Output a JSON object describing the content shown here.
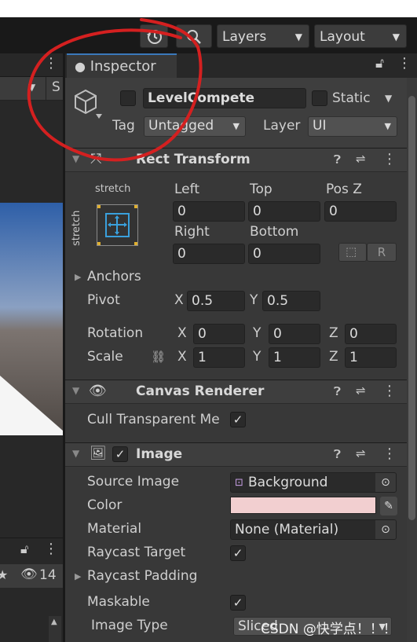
{
  "toolbar": {
    "history_icon": "history-icon",
    "search_icon": "search-icon",
    "layers_label": "Layers",
    "layout_label": "Layout"
  },
  "left_panel": {
    "tool_fragment": "S",
    "lock_icon": "lock-icon",
    "bottom_count": "14"
  },
  "inspector": {
    "tab_label": "Inspector",
    "object": {
      "name": "LevelCompete",
      "static_label": "Static",
      "tag_label": "Tag",
      "tag_value": "Untagged",
      "layer_label": "Layer",
      "layer_value": "UI"
    },
    "rect_transform": {
      "title": "Rect Transform",
      "anchor_top": "stretch",
      "anchor_side": "stretch",
      "left_label": "Left",
      "left_value": "0",
      "top_label": "Top",
      "top_value": "0",
      "posz_label": "Pos Z",
      "posz_value": "0",
      "right_label": "Right",
      "right_value": "0",
      "bottom_label": "Bottom",
      "bottom_value": "0",
      "r_button": "R",
      "anchors_label": "Anchors",
      "pivot_label": "Pivot",
      "pivot_x_label": "X",
      "pivot_x": "0.5",
      "pivot_y_label": "Y",
      "pivot_y": "0.5",
      "rotation_label": "Rotation",
      "rot_x_label": "X",
      "rot_x": "0",
      "rot_y_label": "Y",
      "rot_y": "0",
      "rot_z_label": "Z",
      "rot_z": "0",
      "scale_label": "Scale",
      "scale_x_label": "X",
      "scale_x": "1",
      "scale_y_label": "Y",
      "scale_y": "1",
      "scale_z_label": "Z",
      "scale_z": "1"
    },
    "canvas_renderer": {
      "title": "Canvas Renderer",
      "cull_label": "Cull Transparent Me",
      "cull_checked": "✓"
    },
    "image": {
      "title": "Image",
      "enabled_check": "✓",
      "source_label": "Source Image",
      "source_value": "Background",
      "color_label": "Color",
      "color_value": "#f2cfd0",
      "material_label": "Material",
      "material_value": "None (Material)",
      "raycast_target_label": "Raycast Target",
      "raycast_target_check": "✓",
      "raycast_padding_label": "Raycast Padding",
      "maskable_label": "Maskable",
      "maskable_check": "✓",
      "image_type_label": "Image Type",
      "image_type_value": "Sliced"
    }
  },
  "watermark": "CSDN @快学点！！！",
  "colors": {
    "panel_bg": "#383838",
    "header_bg": "#3e3e3e",
    "field_bg": "#2a2a2a",
    "accent_blue": "#3a79bb",
    "annotation_red": "#d42020"
  }
}
